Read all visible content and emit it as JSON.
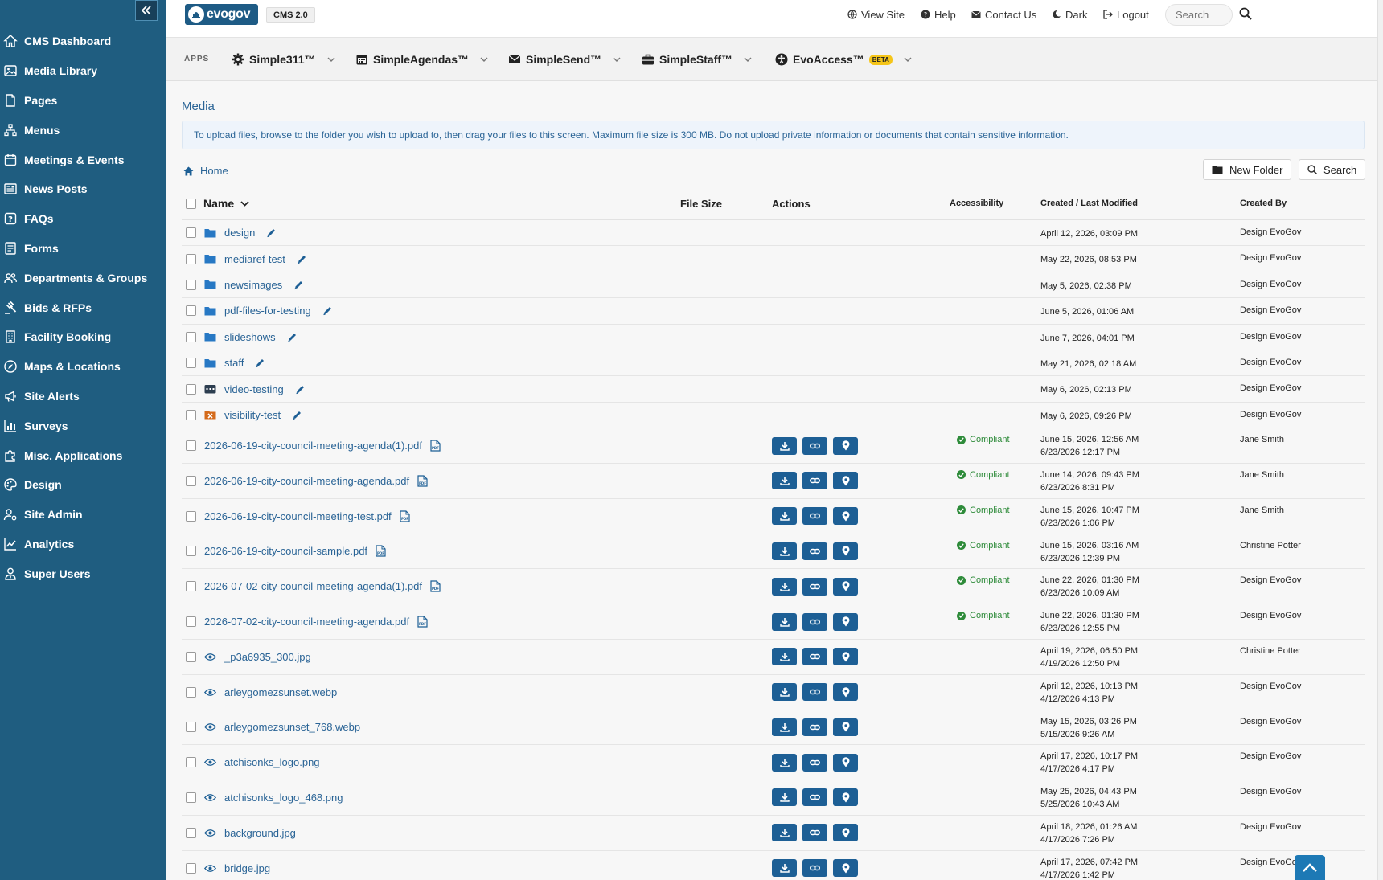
{
  "sidebar": {
    "items": [
      {
        "label": "CMS Dashboard",
        "icon": "home-icon"
      },
      {
        "label": "Media Library",
        "icon": "image-icon"
      },
      {
        "label": "Pages",
        "icon": "page-icon"
      },
      {
        "label": "Menus",
        "icon": "sitemap-icon"
      },
      {
        "label": "Meetings & Events",
        "icon": "calendar-icon"
      },
      {
        "label": "News Posts",
        "icon": "newspaper-icon"
      },
      {
        "label": "FAQs",
        "icon": "question-icon"
      },
      {
        "label": "Forms",
        "icon": "form-icon"
      },
      {
        "label": "Departments & Groups",
        "icon": "users-icon"
      },
      {
        "label": "Bids & RFPs",
        "icon": "gavel-icon"
      },
      {
        "label": "Facility Booking",
        "icon": "building-icon"
      },
      {
        "label": "Maps & Locations",
        "icon": "compass-icon"
      },
      {
        "label": "Site Alerts",
        "icon": "bullhorn-icon"
      },
      {
        "label": "Surveys",
        "icon": "bar-chart-icon"
      },
      {
        "label": "Misc. Applications",
        "icon": "puzzle-icon"
      },
      {
        "label": "Design",
        "icon": "palette-icon"
      },
      {
        "label": "Site Admin",
        "icon": "user-gear-icon"
      },
      {
        "label": "Analytics",
        "icon": "line-chart-icon"
      },
      {
        "label": "Super Users",
        "icon": "user-tie-icon"
      }
    ]
  },
  "topbar": {
    "logo_text": "evogov",
    "cms_badge": "CMS 2.0",
    "view_site": "View Site",
    "help": "Help",
    "contact_us": "Contact Us",
    "dark": "Dark",
    "logout": "Logout",
    "search_placeholder": "Search"
  },
  "apps": {
    "label": "APPS",
    "items": [
      {
        "label": "Simple311™"
      },
      {
        "label": "SimpleAgendas™"
      },
      {
        "label": "SimpleSend™"
      },
      {
        "label": "SimpleStaff™"
      },
      {
        "label": "EvoAccess™",
        "badge": "BETA"
      }
    ]
  },
  "main": {
    "title": "Media",
    "notice": "To upload files, browse to the folder you wish to upload to, then drag your files to this screen. Maximum file size is 300 MB. Do not upload private information or documents that contain sensitive information.",
    "breadcrumb_home": "Home",
    "new_folder": "New Folder",
    "search": "Search"
  },
  "table": {
    "headers": {
      "name": "Name",
      "file_size": "File Size",
      "actions": "Actions",
      "accessibility": "Accessibility",
      "created": "Created / Last Modified",
      "created_by": "Created By"
    },
    "folders": [
      {
        "name": "design",
        "created": "April 12, 2026, 03:09 PM",
        "by": "Design EvoGov",
        "icon": "folder"
      },
      {
        "name": "mediaref-test",
        "created": "May 22, 2026, 08:53 PM",
        "by": "Design EvoGov",
        "icon": "folder"
      },
      {
        "name": "newsimages",
        "created": "May 5, 2026, 02:38 PM",
        "by": "Design EvoGov",
        "icon": "folder"
      },
      {
        "name": "pdf-files-for-testing",
        "created": "June 5, 2026, 01:06 AM",
        "by": "Design EvoGov",
        "icon": "folder"
      },
      {
        "name": "slideshows",
        "created": "June 7, 2026, 04:01 PM",
        "by": "Design EvoGov",
        "icon": "folder"
      },
      {
        "name": "staff",
        "created": "May 21, 2026, 02:18 AM",
        "by": "Design EvoGov",
        "icon": "folder"
      },
      {
        "name": "video-testing",
        "created": "May 6, 2026, 02:13 PM",
        "by": "Design EvoGov",
        "icon": "video-folder"
      },
      {
        "name": "visibility-test",
        "created": "May 6, 2026, 09:26 PM",
        "by": "Design EvoGov",
        "icon": "hidden-folder"
      }
    ],
    "files": [
      {
        "name": "2026-06-19-city-council-meeting-agenda(1).pdf",
        "type": "pdf",
        "access": "Compliant",
        "created": "June 15, 2026, 12:56 AM",
        "modified": "6/23/2026 12:17 PM",
        "by": "Jane Smith"
      },
      {
        "name": "2026-06-19-city-council-meeting-agenda.pdf",
        "type": "pdf",
        "access": "Compliant",
        "created": "June 14, 2026, 09:43 PM",
        "modified": "6/23/2026 8:31 PM",
        "by": "Jane Smith"
      },
      {
        "name": "2026-06-19-city-council-meeting-test.pdf",
        "type": "pdf",
        "access": "Compliant",
        "created": "June 15, 2026, 10:47 PM",
        "modified": "6/23/2026 1:06 PM",
        "by": "Jane Smith"
      },
      {
        "name": "2026-06-19-city-council-sample.pdf",
        "type": "pdf",
        "access": "Compliant",
        "created": "June 15, 2026, 03:16 AM",
        "modified": "6/23/2026 12:39 PM",
        "by": "Christine Potter"
      },
      {
        "name": "2026-07-02-city-council-meeting-agenda(1).pdf",
        "type": "pdf",
        "access": "Compliant",
        "created": "June 22, 2026, 01:30 PM",
        "modified": "6/23/2026 10:09 AM",
        "by": "Design EvoGov"
      },
      {
        "name": "2026-07-02-city-council-meeting-agenda.pdf",
        "type": "pdf",
        "access": "Compliant",
        "created": "June 22, 2026, 01:30 PM",
        "modified": "6/23/2026 12:55 PM",
        "by": "Design EvoGov"
      },
      {
        "name": "_p3a6935_300.jpg",
        "type": "image",
        "access": "",
        "created": "April 19, 2026, 06:50 PM",
        "modified": "4/19/2026 12:50 PM",
        "by": "Christine Potter"
      },
      {
        "name": "arleygomezsunset.webp",
        "type": "image",
        "access": "",
        "created": "April 12, 2026, 10:13 PM",
        "modified": "4/12/2026 4:13 PM",
        "by": "Design EvoGov"
      },
      {
        "name": "arleygomezsunset_768.webp",
        "type": "image",
        "access": "",
        "created": "May 15, 2026, 03:26 PM",
        "modified": "5/15/2026 9:26 AM",
        "by": "Design EvoGov"
      },
      {
        "name": "atchisonks_logo.png",
        "type": "image",
        "access": "",
        "created": "April 17, 2026, 10:17 PM",
        "modified": "4/17/2026 4:17 PM",
        "by": "Design EvoGov"
      },
      {
        "name": "atchisonks_logo_468.png",
        "type": "image",
        "access": "",
        "created": "May 25, 2026, 04:43 PM",
        "modified": "5/25/2026 10:43 AM",
        "by": "Design EvoGov"
      },
      {
        "name": "background.jpg",
        "type": "image",
        "access": "",
        "created": "April 18, 2026, 01:26 AM",
        "modified": "4/17/2026 7:26 PM",
        "by": "Design EvoGov"
      },
      {
        "name": "bridge.jpg",
        "type": "image",
        "access": "",
        "created": "April 17, 2026, 07:42 PM",
        "modified": "4/17/2026 1:42 PM",
        "by": "Design EvoGov"
      }
    ]
  },
  "colors": {
    "sidebar": "#1f5d80",
    "link": "#2a6496",
    "action_button": "#1d5f95",
    "compliant": "#2e8b3a",
    "folder": "#2778c4"
  }
}
